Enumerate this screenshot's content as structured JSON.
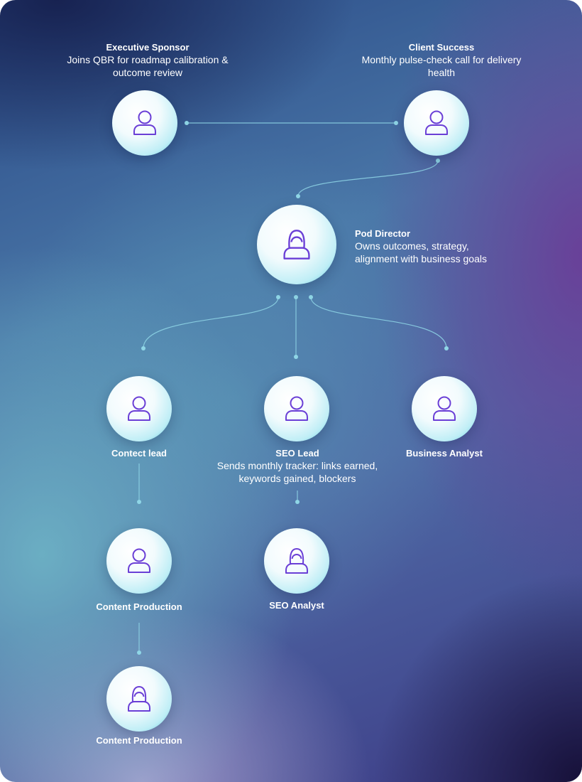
{
  "diagram": {
    "colors": {
      "icon_stroke": "#6a3fd6",
      "connector": "#8fd6e6",
      "node_glow": "#46c4d8"
    },
    "nodes": [
      {
        "id": "executive_sponsor",
        "name": "Executive Sponsor",
        "desc": "Joins QBR for roadmap calibration & outcome review",
        "icon": "person-icon"
      },
      {
        "id": "client_success",
        "name": "Client Success",
        "desc": "Monthly pulse-check call for delivery health",
        "icon": "person-icon"
      },
      {
        "id": "pod_director",
        "name": "Pod Director",
        "desc": "Owns outcomes, strategy, alignment with business goals",
        "icon": "person-female-icon"
      },
      {
        "id": "content_lead",
        "name": "Contect lead",
        "icon": "person-icon"
      },
      {
        "id": "seo_lead",
        "name": "SEO Lead",
        "desc": "Sends monthly tracker: links earned, keywords gained, blockers",
        "icon": "person-icon"
      },
      {
        "id": "business_analyst",
        "name": "Business Analyst",
        "icon": "person-icon"
      },
      {
        "id": "content_production_1",
        "name": "Content Production",
        "icon": "person-icon"
      },
      {
        "id": "seo_analyst",
        "name": "SEO Analyst",
        "icon": "person-female-icon"
      },
      {
        "id": "content_production_2",
        "name": "Content Production",
        "icon": "person-female-icon"
      }
    ],
    "edges": [
      {
        "from": "executive_sponsor",
        "to": "client_success"
      },
      {
        "from": "client_success",
        "to": "pod_director"
      },
      {
        "from": "pod_director",
        "to": "content_lead"
      },
      {
        "from": "pod_director",
        "to": "seo_lead"
      },
      {
        "from": "pod_director",
        "to": "business_analyst"
      },
      {
        "from": "content_lead",
        "to": "content_production_1"
      },
      {
        "from": "seo_lead",
        "to": "seo_analyst"
      },
      {
        "from": "content_production_1",
        "to": "content_production_2"
      }
    ]
  }
}
